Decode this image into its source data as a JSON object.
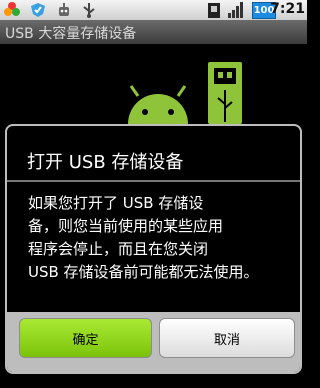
{
  "status_bar": {
    "time": "7:21",
    "battery": "100",
    "icons": [
      "flower-icon",
      "shield-icon",
      "robot-icon",
      "usb-icon",
      "sim-card-icon",
      "signal-icon",
      "battery-icon"
    ]
  },
  "title_bar": {
    "title": "USB 大容量存储设备"
  },
  "dialog": {
    "title": "打开 USB 存储设备",
    "message_lines": [
      "如果您打开了 USB 存储设",
      "备，则您当前使用的某些应用",
      "程序会停止，而且在您关闭",
      "USB 存储设备前可能都无法使用。"
    ],
    "ok_label": "确定",
    "cancel_label": "取消"
  },
  "colors": {
    "accent_green": "#8cd419",
    "android_green": "#8fc43a"
  }
}
